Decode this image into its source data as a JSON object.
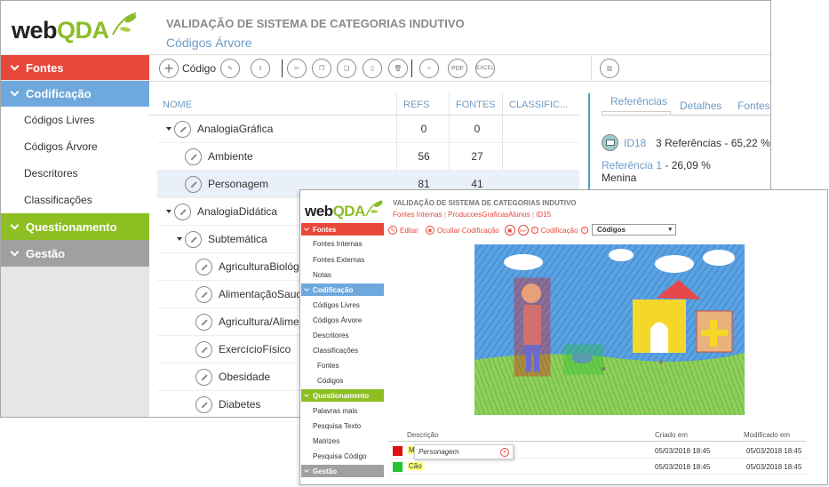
{
  "colors": {
    "fontes": "#e8473b",
    "codificacao": "#6fa8dc",
    "questionamento": "#8dbe22",
    "gestao": "#a0a0a0",
    "accent": "#6e9bc5"
  },
  "back": {
    "logo": {
      "main": "web",
      "accent": "QDA"
    },
    "header": {
      "title": "VALIDAÇÃO DE SISTEMA DE CATEGORIAS INDUTIVO",
      "subtitle": "Códigos Árvore"
    },
    "sidebar": {
      "fontes": "Fontes",
      "codificacao": "Codificação",
      "items": [
        "Códigos Livres",
        "Códigos Árvore",
        "Descritores",
        "Classificações"
      ],
      "questionamento": "Questionamento",
      "gestao": "Gestão"
    },
    "toolbar": {
      "add_label": "Código",
      "pdf": "PDF",
      "excel": "EXCEL"
    },
    "table": {
      "headers": [
        "NOME",
        "REFS",
        "FONTES",
        "CLASSIFIC..."
      ],
      "rows": [
        {
          "name": "AnalogiaGráfica",
          "refs": "0",
          "fontes": "0"
        },
        {
          "name": "Ambiente",
          "refs": "56",
          "fontes": "27"
        },
        {
          "name": "Personagem",
          "refs": "81",
          "fontes": "41"
        },
        {
          "name": "AnalogiaDidática",
          "refs": "",
          "fontes": ""
        },
        {
          "name": "Subtemática",
          "refs": "",
          "fontes": ""
        },
        {
          "name": "AgriculturaBiológica",
          "refs": "",
          "fontes": ""
        },
        {
          "name": "AlimentaçãoSaudável",
          "refs": "",
          "fontes": ""
        },
        {
          "name": "Agricultura/Alimentação",
          "refs": "",
          "fontes": ""
        },
        {
          "name": "ExercícioFísico",
          "refs": "",
          "fontes": ""
        },
        {
          "name": "Obesidade",
          "refs": "",
          "fontes": ""
        },
        {
          "name": "Diabetes",
          "refs": "",
          "fontes": ""
        }
      ]
    },
    "panel": {
      "tabs": [
        "Referências",
        "Detalhes",
        "Fontes"
      ],
      "source_id": "ID18",
      "ref_summary": "3 Referências - 65,22 %",
      "ref_link": "Referência 1",
      "ref_pct": " - 26,09 %",
      "ref_text": "Menina"
    }
  },
  "front": {
    "logo": {
      "main": "web",
      "accent": "QDA"
    },
    "header": {
      "title": "VALIDAÇÃO DE SISTEMA DE CATEGORIAS INDUTIVO",
      "crumbs": [
        "Fontes Internas",
        "ProducoesGraficasAlunos",
        "ID15"
      ]
    },
    "sidebar": {
      "fontes": "Fontes",
      "fontes_items": [
        "Fontes Internas",
        "Fontes Externas",
        "Notas"
      ],
      "codificacao": "Codificação",
      "cod_items": [
        "Códigos Livres",
        "Códigos Árvore",
        "Descritores",
        "Classificações"
      ],
      "class_sub": [
        "Fontes",
        "Códigos"
      ],
      "questionamento": "Questionamento",
      "quest_items": [
        "Palavras mais",
        "Pesquisa Texto",
        "Matrizes",
        "Pesquisa Código"
      ],
      "gestao": "Gestão"
    },
    "toolbar": {
      "edit": "Editar",
      "hide": "Ocultar Codificação",
      "pdf": "PDF",
      "codificacao": "Codificação",
      "select": "Códigos"
    },
    "table": {
      "headers": [
        "Descrição",
        "Criado em",
        "Modificado em"
      ],
      "rows": [
        {
          "desc": "M",
          "created": "05/03/2018 18:45",
          "modified": "05/03/2018 18:45",
          "color": "#e01010"
        },
        {
          "desc": "Cão",
          "created": "05/03/2018 18:45",
          "modified": "05/03/2018 18:45",
          "color": "#22c232"
        }
      ],
      "tooltip": "Personagem"
    }
  }
}
